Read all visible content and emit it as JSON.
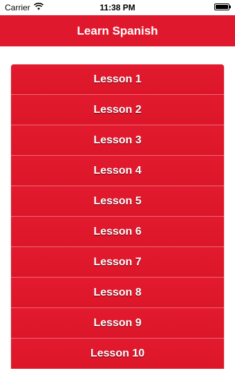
{
  "status_bar": {
    "carrier": "Carrier",
    "time": "11:38 PM"
  },
  "nav_bar": {
    "title": "Learn Spanish"
  },
  "lessons": [
    {
      "label": "Lesson 1"
    },
    {
      "label": "Lesson 2"
    },
    {
      "label": "Lesson 3"
    },
    {
      "label": "Lesson 4"
    },
    {
      "label": "Lesson 5"
    },
    {
      "label": "Lesson 6"
    },
    {
      "label": "Lesson 7"
    },
    {
      "label": "Lesson 8"
    },
    {
      "label": "Lesson 9"
    },
    {
      "label": "Lesson 10"
    }
  ],
  "colors": {
    "accent": "#e0182d",
    "text_on_accent": "#ffffff"
  }
}
